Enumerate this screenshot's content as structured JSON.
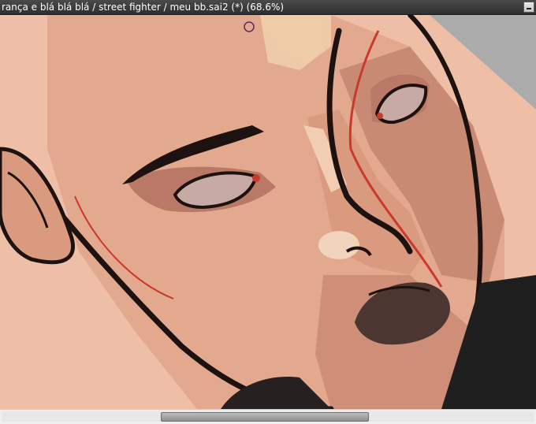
{
  "window": {
    "title": "rança e blá blá blá / street fighter / meu bb.sai2 (*) (68.6%)",
    "controls": [
      "minimize-icon"
    ]
  },
  "canvas": {
    "content": "digital painting of a face close-up",
    "colors": {
      "background_gray": "#ababab",
      "skin_light": "#eebfa6",
      "skin_mid": "#d99a80",
      "skin_shadow": "#b97966",
      "line_dark": "#1d1210",
      "accent_red": "#c93a2b",
      "lips": "#4b3632",
      "eye_white": "#c8aaa4",
      "clothing": "#1f1f1f"
    },
    "cursor": "brush-circle-cursor"
  },
  "scrollbar": {
    "orientation": "horizontal"
  }
}
